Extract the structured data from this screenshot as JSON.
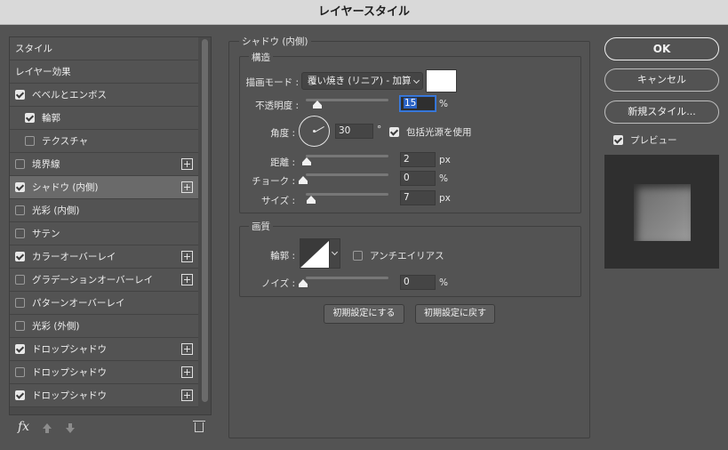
{
  "window": {
    "title": "レイヤースタイル"
  },
  "style_list": {
    "items": [
      {
        "label": "スタイル",
        "checkbox": "none",
        "plus": false,
        "selected": false,
        "indent": 0
      },
      {
        "label": "レイヤー効果",
        "checkbox": "none",
        "plus": false,
        "selected": false,
        "indent": 0
      },
      {
        "label": "ベベルとエンボス",
        "checkbox": "checked",
        "plus": false,
        "selected": false,
        "indent": 0
      },
      {
        "label": "輪郭",
        "checkbox": "checked",
        "plus": false,
        "selected": false,
        "indent": 1
      },
      {
        "label": "テクスチャ",
        "checkbox": "unchecked",
        "plus": false,
        "selected": false,
        "indent": 1
      },
      {
        "label": "境界線",
        "checkbox": "unchecked",
        "plus": true,
        "selected": false,
        "indent": 0
      },
      {
        "label": "シャドウ (内側)",
        "checkbox": "checked",
        "plus": true,
        "selected": true,
        "indent": 0
      },
      {
        "label": "光彩 (内側)",
        "checkbox": "unchecked",
        "plus": false,
        "selected": false,
        "indent": 0
      },
      {
        "label": "サテン",
        "checkbox": "unchecked",
        "plus": false,
        "selected": false,
        "indent": 0
      },
      {
        "label": "カラーオーバーレイ",
        "checkbox": "checked",
        "plus": true,
        "selected": false,
        "indent": 0
      },
      {
        "label": "グラデーションオーバーレイ",
        "checkbox": "unchecked",
        "plus": true,
        "selected": false,
        "indent": 0
      },
      {
        "label": "パターンオーバーレイ",
        "checkbox": "unchecked",
        "plus": false,
        "selected": false,
        "indent": 0
      },
      {
        "label": "光彩 (外側)",
        "checkbox": "unchecked",
        "plus": false,
        "selected": false,
        "indent": 0
      },
      {
        "label": "ドロップシャドウ",
        "checkbox": "checked",
        "plus": true,
        "selected": false,
        "indent": 0
      },
      {
        "label": "ドロップシャドウ",
        "checkbox": "unchecked",
        "plus": true,
        "selected": false,
        "indent": 0
      },
      {
        "label": "ドロップシャドウ",
        "checkbox": "checked",
        "plus": true,
        "selected": false,
        "indent": 0
      }
    ],
    "footer": {
      "fx_label": "fx"
    }
  },
  "panel": {
    "title": "シャドウ (内側)",
    "structure": {
      "title": "構造",
      "blend_mode_label": "描画モード :",
      "blend_mode_value": "覆い焼き (リニア) - 加算",
      "shadow_color": "#ffffff",
      "opacity_label": "不透明度 :",
      "opacity_value": "15",
      "opacity_level": 15,
      "opacity_unit": "%",
      "angle_label": "角度 :",
      "angle_value": "30",
      "angle_unit": "°",
      "global_light_label": "包括光源を使用",
      "global_light_checked": true,
      "distance_label": "距離 :",
      "distance_value": "2",
      "distance_unit": "px",
      "choke_label": "チョーク :",
      "choke_value": "0",
      "choke_unit": "%",
      "size_label": "サイズ :",
      "size_value": "7",
      "size_unit": "px"
    },
    "quality": {
      "title": "画質",
      "contour_label": "輪郭 :",
      "antialias_label": "アンチエイリアス",
      "antialias_checked": false,
      "noise_label": "ノイズ :",
      "noise_value": "0",
      "noise_unit": "%"
    },
    "make_default_label": "初期設定にする",
    "reset_default_label": "初期設定に戻す"
  },
  "actions": {
    "ok_label": "OK",
    "cancel_label": "キャンセル",
    "new_style_label": "新規スタイル...",
    "preview_label": "プレビュー",
    "preview_checked": true
  }
}
